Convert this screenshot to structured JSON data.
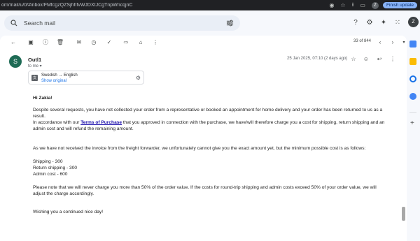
{
  "browser": {
    "url": "om/mail/u/0/#inbox/FMfcgzQZSjhhfvWJDXtJCgTnpWncqjnC",
    "avatar": "Z",
    "finish_update": "Finish update"
  },
  "header": {
    "search_placeholder": "Search mail",
    "avatar": "Z"
  },
  "toolbar": {
    "pager": "33 of 844"
  },
  "message": {
    "sender_initial": "S",
    "sender": "Outl1",
    "to_me": "to me ▾",
    "date": "25 Jan 2025, 07:10 (2 days ago)"
  },
  "translate": {
    "lang": "Swedish → English",
    "show_original": "Show original"
  },
  "body": {
    "greeting": "Hi Zakia!",
    "p1": "Despite several requests, you have not collected your order from a representative or booked an appointment for home delivery and your order has been returned to us as a result.",
    "p2_before": "In accordance with our ",
    "p2_link": "Terms of Purchase",
    "p2_after": " that you approved in connection with the purchase, we have/will therefore charge you a cost for shipping, return shipping and an admin cost and will refund the remaining amount.",
    "p3": "As we have not received the invoice from the freight forwarder, we unfortunately cannot give you the exact amount yet, but the minimum possible cost is as follows:",
    "cost1": "Shipping - 300",
    "cost2": "Return shipping - 300",
    "cost3": "Admin cost - 600",
    "p4": "Please note that we will never charge you more than 50% of the order value. If the costs for round-trip shipping and admin costs exceed 50% of your order value, we will adjust the charge accordingly.",
    "closing": "Wishing you a continued nice day!"
  },
  "colors": {
    "accent": "#1a73e8",
    "sender_avatar": "#1e6b55"
  }
}
